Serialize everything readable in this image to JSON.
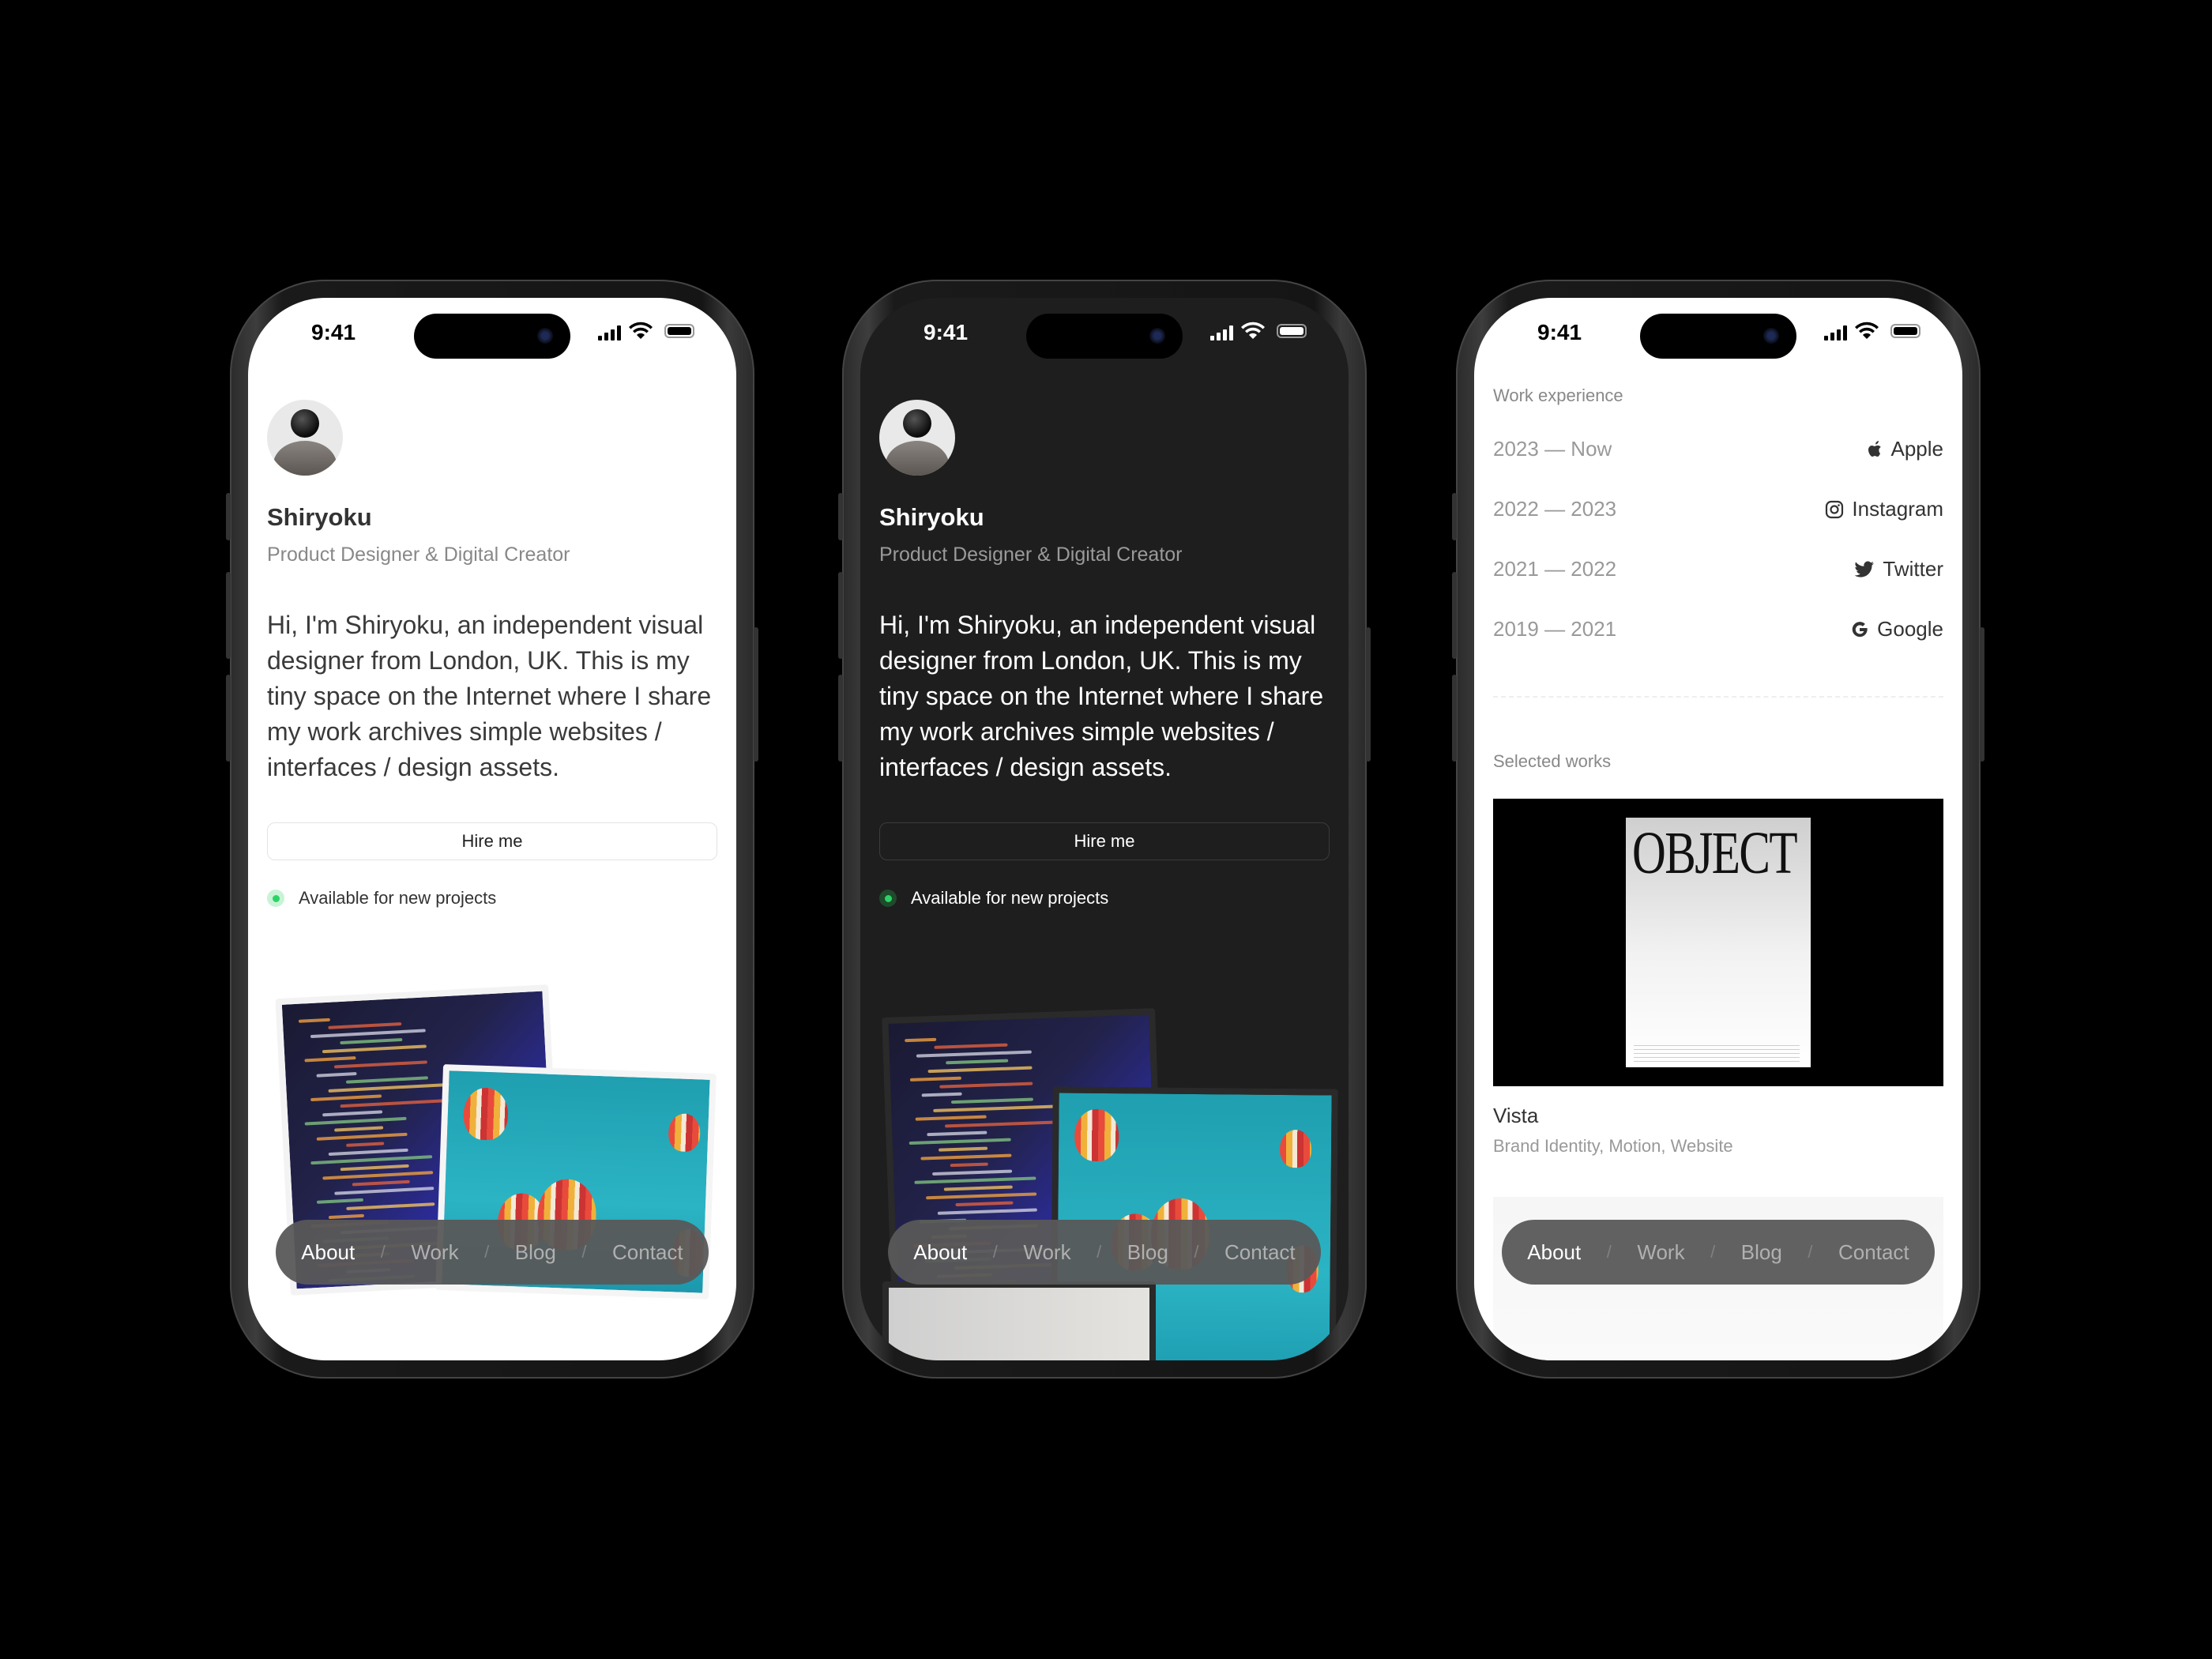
{
  "status_bar": {
    "time": "9:41",
    "signal_icon": "cellular-signal-icon",
    "wifi_icon": "wifi-icon",
    "battery_icon": "battery-icon"
  },
  "profile": {
    "name": "Shiryoku",
    "role": "Product Designer & Digital Creator",
    "bio": "Hi, I'm Shiryoku, an independent visual designer from London, UK. This is my tiny space on the Internet where I share my work archives simple websites / interfaces / design assets.",
    "hire_label": "Hire me",
    "availability": "Available for new projects",
    "availability_color": "#2dd267"
  },
  "nav": {
    "items": [
      "About",
      "Work",
      "Blog",
      "Contact"
    ],
    "active": "About",
    "separator": "/"
  },
  "work_experience": {
    "label": "Work experience",
    "items": [
      {
        "years": "2023 — Now",
        "company": "Apple",
        "icon": "apple-icon"
      },
      {
        "years": "2022 — 2023",
        "company": "Instagram",
        "icon": "instagram-icon"
      },
      {
        "years": "2021 — 2022",
        "company": "Twitter",
        "icon": "twitter-icon"
      },
      {
        "years": "2019 — 2021",
        "company": "Google",
        "icon": "google-icon"
      }
    ]
  },
  "selected_works": {
    "label": "Selected works",
    "items": [
      {
        "title": "Vista",
        "tags": "Brand Identity, Motion, Website",
        "poster_text": "OBJECT"
      }
    ]
  },
  "themes": {
    "light_bg": "#ffffff",
    "dark_bg": "#1e1e1e"
  }
}
